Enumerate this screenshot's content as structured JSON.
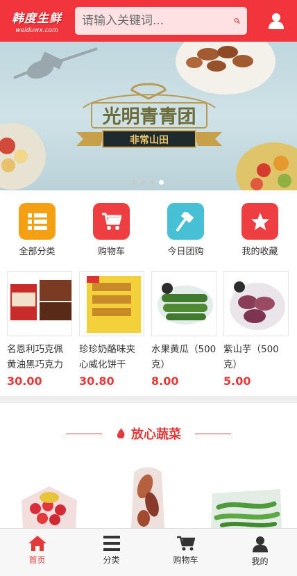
{
  "header": {
    "logo_text": "韩度生鲜",
    "logo_sub": "weiduwx.com",
    "search_placeholder": "请输入关键词...",
    "search_icon": "search-icon",
    "user_icon": "user-icon"
  },
  "banner": {
    "title": "光明青青团",
    "ribbon": "非常山田",
    "dots": 4,
    "active_dot": 4
  },
  "categories": [
    {
      "label": "全部分类",
      "icon": "list-icon",
      "color": "#f5a013"
    },
    {
      "label": "购物车",
      "icon": "cart-icon",
      "color": "#ef3e42"
    },
    {
      "label": "今日团购",
      "icon": "hammer-icon",
      "color": "#47bfd4"
    },
    {
      "label": "我的收藏",
      "icon": "star-icon",
      "color": "#ef3e42"
    }
  ],
  "products": [
    {
      "name": "名恩利巧克佩黄油黑巧克力",
      "price": "30.00"
    },
    {
      "name": "珍珍奶酪味夹心威化饼干",
      "price": "30.80"
    },
    {
      "name": "水果黄瓜（500克）",
      "price": "8.00"
    },
    {
      "name": "紫山芋（500克）",
      "price": "5.00"
    }
  ],
  "section": {
    "title": "放心蔬菜"
  },
  "nav": [
    {
      "label": "首页",
      "icon": "home-icon",
      "active": true
    },
    {
      "label": "分类",
      "icon": "menu-icon",
      "active": false
    },
    {
      "label": "购物车",
      "icon": "cart-icon",
      "active": false
    },
    {
      "label": "我的",
      "icon": "user-icon",
      "active": false
    }
  ],
  "colors": {
    "brand": "#f2343c",
    "price": "#e23a3a"
  }
}
